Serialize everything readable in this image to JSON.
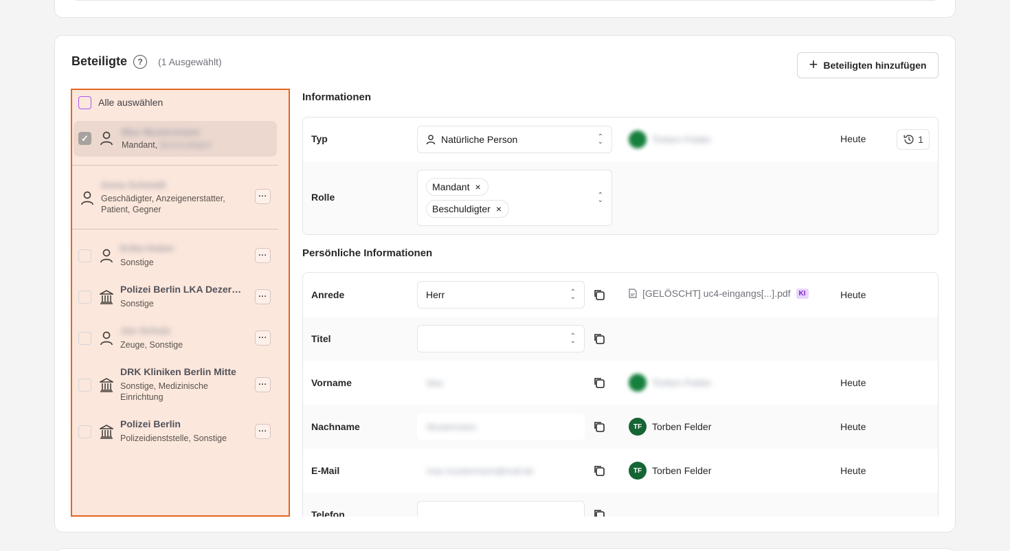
{
  "section": {
    "title": "Beteiligte",
    "help_icon": "?",
    "selection_info": "(1 Ausgewählt)",
    "add_button": "Beteiligten hinzufügen"
  },
  "list": {
    "select_all": "Alle auswählen",
    "items": [
      {
        "name": "Max Mustermann",
        "roles": "Mandant,",
        "roles_blur": "Beschuldigter",
        "type": "person",
        "checked": true
      },
      {
        "name": "Anna Schmidt",
        "roles": "Geschädigter, Anzeigenerstatter, Patient, Gegner",
        "type": "person"
      },
      {
        "name": "Erika Huber",
        "roles": "Sonstige",
        "type": "person"
      },
      {
        "name": "Polizei Berlin LKA Dezer…",
        "roles": "Sonstige",
        "type": "institution"
      },
      {
        "name": "Jan Schulz",
        "roles": "Zeuge, Sonstige",
        "type": "person"
      },
      {
        "name": "DRK Kliniken Berlin Mitte",
        "roles": "Sonstige, Medizinische Einrichtung",
        "type": "institution"
      },
      {
        "name": "Polizei Berlin",
        "roles": "Polizeidienststelle, Sonstige",
        "type": "institution"
      }
    ],
    "more_label": "···"
  },
  "info": {
    "title": "Informationen",
    "typ_label": "Typ",
    "typ_value": "Natürliche Person",
    "typ_source": "Torben Felder",
    "typ_date": "Heute",
    "history_count": "1",
    "rolle_label": "Rolle",
    "roles": [
      "Mandant",
      "Beschuldigter"
    ],
    "remove_glyph": "×"
  },
  "personal": {
    "title": "Persönliche Informationen",
    "rows": {
      "anrede": {
        "label": "Anrede",
        "value": "Herr",
        "source": "[GELÖSCHT] uc4-eingangs[...].pdf",
        "badge": "KI",
        "date": "Heute"
      },
      "titel": {
        "label": "Titel",
        "value": ""
      },
      "vorname": {
        "label": "Vorname",
        "value": "Max",
        "source": "Torben Felder",
        "date": "Heute"
      },
      "nachname": {
        "label": "Nachname",
        "value": "Mustermann",
        "source": "Torben Felder",
        "initials": "TF",
        "date": "Heute"
      },
      "email": {
        "label": "E-Mail",
        "value": "max.mustermann@mail.de",
        "source": "Torben Felder",
        "initials": "TF",
        "date": "Heute"
      },
      "telefon": {
        "label": "Telefon"
      }
    }
  }
}
